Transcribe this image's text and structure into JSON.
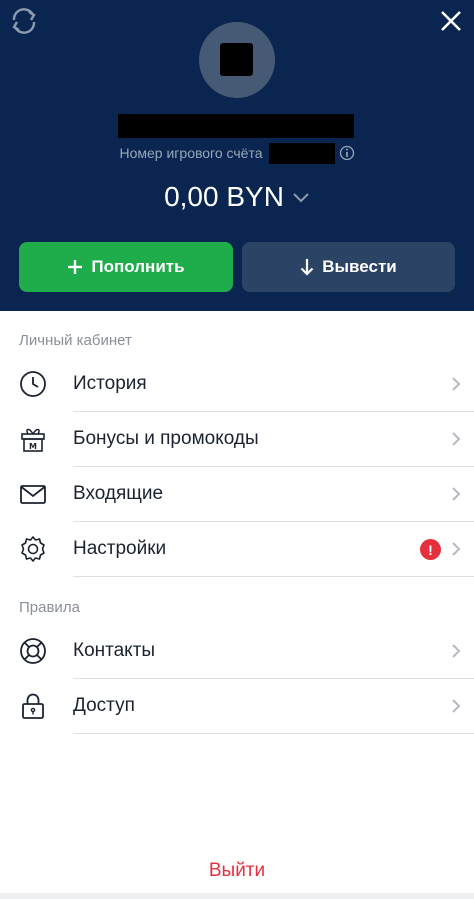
{
  "colors": {
    "header_bg": "#0a2650",
    "deposit_bg": "#1fac4b",
    "withdraw_bg": "#2b4466",
    "alert": "#e5303e",
    "logout": "#e5303e"
  },
  "header": {
    "refresh_icon": "refresh-icon",
    "close_icon": "close-icon",
    "account_label": "Номер игрового счёта",
    "balance": "0,00 BYN",
    "deposit_label": "Пополнить",
    "withdraw_label": "Вывести"
  },
  "sections": {
    "cabinet_title": "Личный кабинет",
    "rules_title": "Правила"
  },
  "menu": {
    "history": "История",
    "bonuses": "Бонусы и промокоды",
    "inbox": "Входящие",
    "settings": "Настройки",
    "settings_badge": "!",
    "contacts": "Контакты",
    "access": "Доступ"
  },
  "logout_label": "Выйти"
}
